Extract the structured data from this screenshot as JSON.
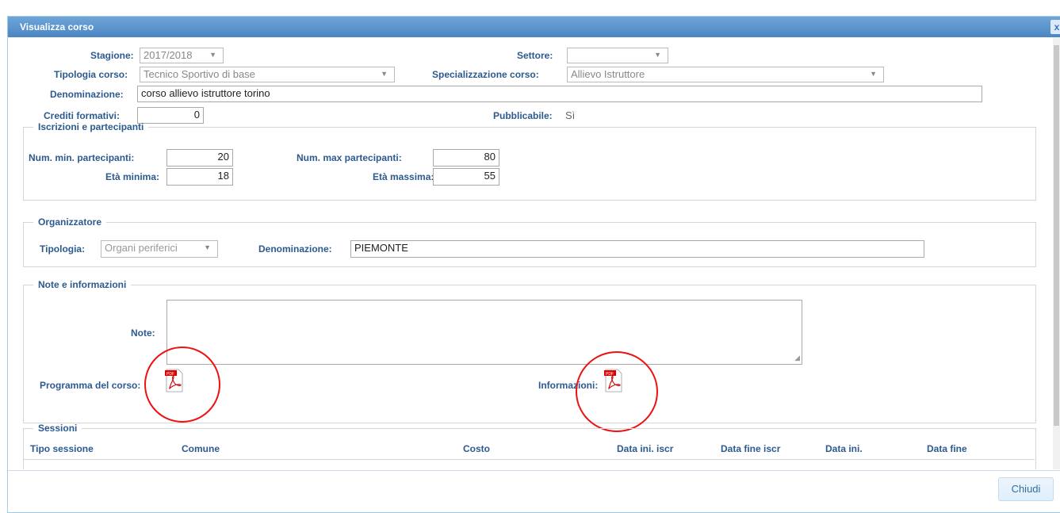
{
  "dialog": {
    "title": "Visualizza corso",
    "close_label": "x"
  },
  "form": {
    "stagione_label": "Stagione:",
    "stagione_value": "2017/2018",
    "settore_label": "Settore:",
    "settore_value": "",
    "tipologia_corso_label": "Tipologia corso:",
    "tipologia_corso_value": "Tecnico Sportivo di base",
    "specializzazione_label": "Specializzazione corso:",
    "specializzazione_value": "Allievo Istruttore",
    "denominazione_label": "Denominazione:",
    "denominazione_value": "corso allievo istruttore torino",
    "crediti_label": "Crediti formativi:",
    "crediti_value": "0",
    "pubblicabile_label": "Pubblicabile:",
    "pubblicabile_value": "Sì"
  },
  "iscrizioni": {
    "legend": "Iscrizioni e partecipanti",
    "min_label": "Num. min. partecipanti:",
    "min_value": "20",
    "max_label": "Num. max partecipanti:",
    "max_value": "80",
    "eta_min_label": "Età minima:",
    "eta_min_value": "18",
    "eta_max_label": "Età massima:",
    "eta_max_value": "55"
  },
  "organizzatore": {
    "legend": "Organizzatore",
    "tipologia_label": "Tipologia:",
    "tipologia_value": "Organi periferici",
    "denominazione_label": "Denominazione:",
    "denominazione_value": "PIEMONTE"
  },
  "note": {
    "legend": "Note e informazioni",
    "note_label": "Note:",
    "note_value": "",
    "programma_label": "Programma del corso:",
    "informazioni_label": "Informazioni:",
    "pdf_badge": "PDF"
  },
  "sessioni": {
    "legend": "Sessioni",
    "columns": [
      "Tipo sessione",
      "Comune",
      "Costo",
      "Data ini. iscr",
      "Data fine iscr",
      "Data ini.",
      "Data fine"
    ]
  },
  "footer": {
    "close_button": "Chiudi"
  },
  "colors": {
    "title_bar": "#4b86c3",
    "label": "#2c5a8f",
    "highlight_circle": "#e11111"
  }
}
